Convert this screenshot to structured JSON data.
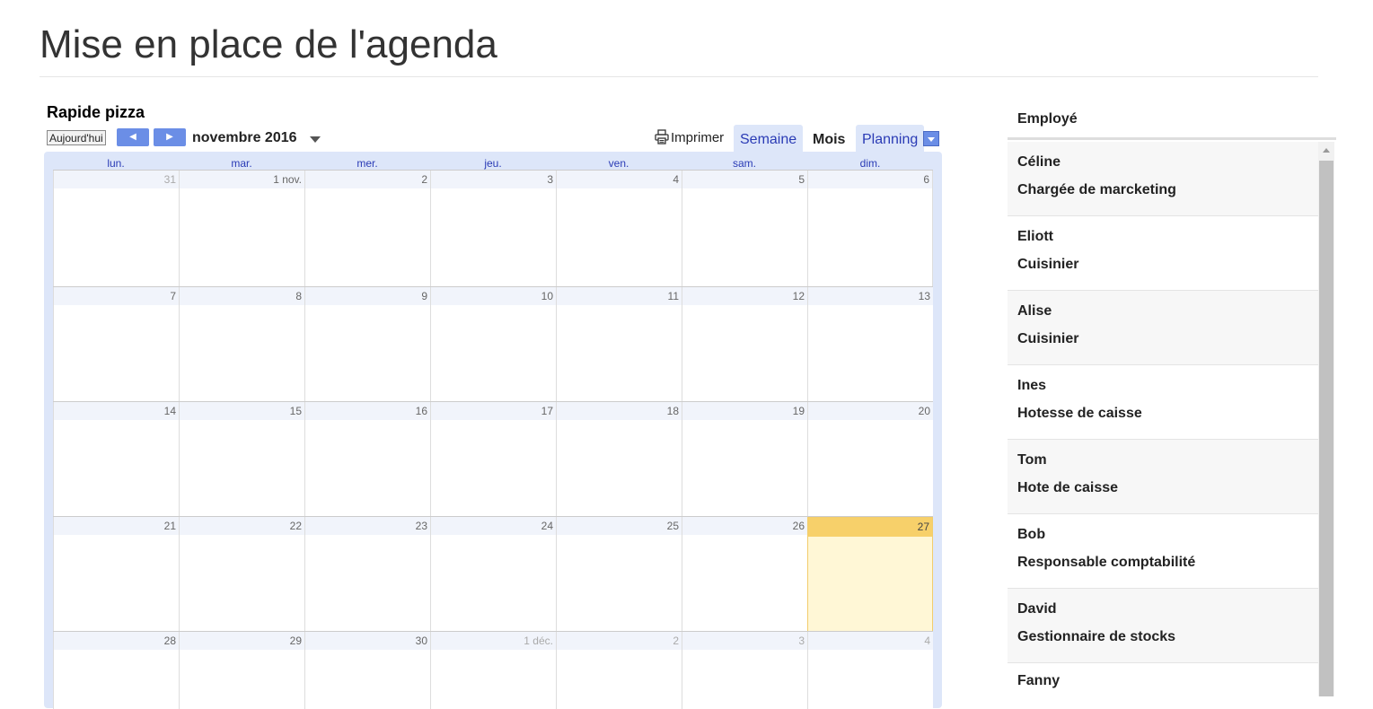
{
  "page": {
    "title": "Mise en place de l'agenda"
  },
  "calendar": {
    "name": "Rapide pizza",
    "today_button": "Aujourd'hui",
    "month_label": "novembre 2016",
    "print_label": "Imprimer",
    "views": [
      "Semaine",
      "Mois",
      "Planning"
    ],
    "active_view": "Mois",
    "weekdays": [
      "lun.",
      "mar.",
      "mer.",
      "jeu.",
      "ven.",
      "sam.",
      "dim."
    ],
    "weeks": [
      [
        "31",
        "1 nov.",
        "2",
        "3",
        "4",
        "5",
        "6"
      ],
      [
        "7",
        "8",
        "9",
        "10",
        "11",
        "12",
        "13"
      ],
      [
        "14",
        "15",
        "16",
        "17",
        "18",
        "19",
        "20"
      ],
      [
        "21",
        "22",
        "23",
        "24",
        "25",
        "26",
        "27"
      ],
      [
        "28",
        "29",
        "30",
        "1 déc.",
        "2",
        "3",
        "4"
      ]
    ],
    "today": "27",
    "colors": {
      "accent": "#6b8ee6",
      "today_header": "#f7d06a",
      "today_cell": "#fff7d6",
      "frame": "#dde6f9"
    }
  },
  "employees": {
    "header": "Employé",
    "items": [
      {
        "name": "Céline",
        "role": "Chargée de marcketing"
      },
      {
        "name": "Eliott",
        "role": "Cuisinier"
      },
      {
        "name": "Alise",
        "role": "Cuisinier"
      },
      {
        "name": "Ines",
        "role": "Hotesse de caisse"
      },
      {
        "name": "Tom",
        "role": "Hote de caisse"
      },
      {
        "name": "Bob",
        "role": "Responsable comptabilité"
      },
      {
        "name": "David",
        "role": "Gestionnaire de stocks"
      },
      {
        "name": "Fanny",
        "role": ""
      }
    ]
  }
}
